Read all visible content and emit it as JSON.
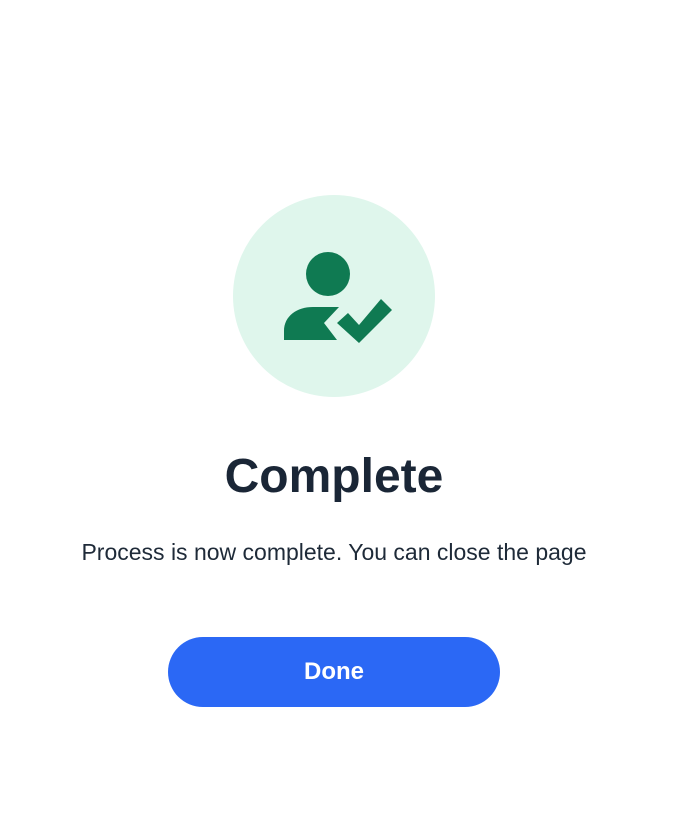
{
  "status": {
    "icon": "user-check-icon",
    "title": "Complete",
    "message": "Process is now complete. You can close the page"
  },
  "actions": {
    "done_label": "Done"
  },
  "colors": {
    "icon_background": "#dff6ec",
    "icon_foreground": "#0f7a52",
    "primary_button": "#2b68f5",
    "title_text": "#1a2636",
    "body_text": "#1e2a38"
  }
}
